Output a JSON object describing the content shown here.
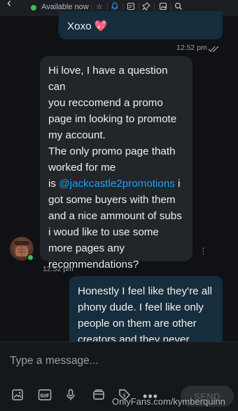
{
  "header": {
    "status": "Available now"
  },
  "messages": [
    {
      "text": "Xoxo 💖",
      "time": "12:52 pm"
    },
    {
      "lines": [
        "Hi love, I have a question can",
        "you reccomend a promo",
        "page im looking to promote",
        "my account.",
        "The only promo page thath",
        "worked for me"
      ],
      "mention_prefix": "is ",
      "mention": "@jackcastle2promotions",
      "mention_suffix": " i",
      "lines2": [
        "got some buyers with them",
        "and a nice ammount of subs",
        "i woud like to use some",
        "more pages any",
        "recommendations?"
      ],
      "time": "12:52 pm"
    },
    {
      "lines": [
        "Honestly I feel like they're all",
        "phony dude. I feel like only",
        "people on them are other",
        "creators and they never"
      ]
    }
  ],
  "composer": {
    "placeholder": "Type a message...",
    "send": "SEND"
  },
  "watermark": "OnlyFans.com/kymberquinn",
  "colors": {
    "accent": "#1da1f2",
    "online": "#3fbf4f",
    "out_bubble": "#152d3c",
    "in_bubble": "#22252a"
  }
}
